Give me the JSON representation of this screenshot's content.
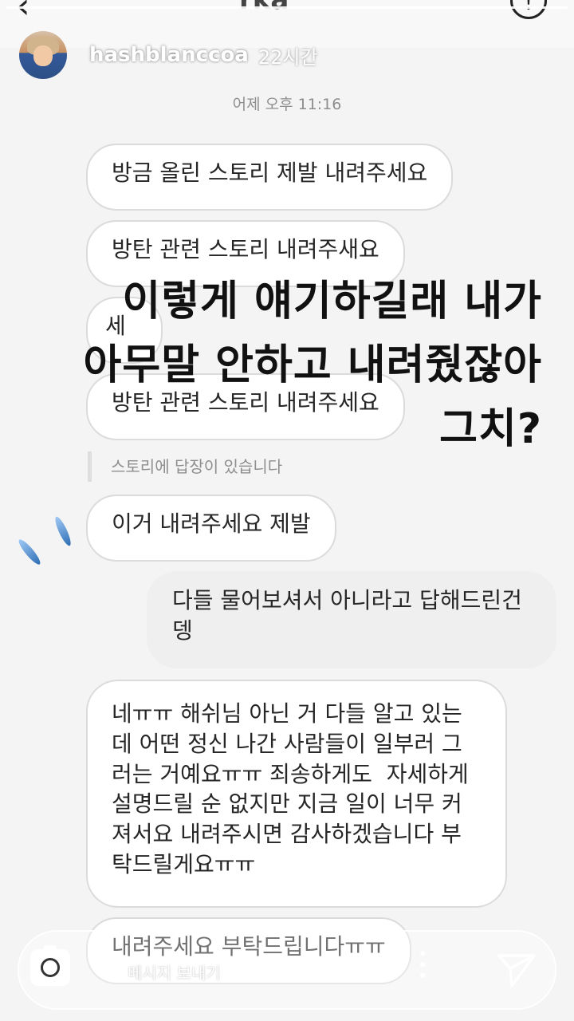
{
  "top_bar": {
    "back_glyph": "‹",
    "title_partial": "rka",
    "info_glyph": "!"
  },
  "story": {
    "username": "hashblanccoa",
    "time": "22시간"
  },
  "chat": {
    "date": "어제 오후 11:16",
    "messages": [
      {
        "text": "방금 올린 스토리 제발 내려주세요",
        "from": "other"
      },
      {
        "text": "방탄 관련 스토리 내려주새요",
        "from": "other"
      },
      {
        "text": "세",
        "from": "other"
      },
      {
        "text": "방탄 관련 스토리 내려주세요",
        "from": "other"
      },
      {
        "text": "이거 내려주세요 제발",
        "from": "other"
      },
      {
        "text": "다들 물어보셔서 아니라고 답해드린건\n뎅",
        "from": "me"
      },
      {
        "text": "네ㅠㅠ 해쉬님 아닌 거 다들 알고 있는\n데 어떤 정신 나간 사람들이 일부러 그\n러는 거예요ㅠㅠ 죄송하게도  자세하게\n설명드릴 순 없지만 지금 일이 너무 커\n져서요 내려주시면 감사하겠습니다 부\n탁드릴게요ㅠㅠ",
        "from": "other"
      },
      {
        "text": "내려주세요 부탁드립니다ㅠㅠ",
        "from": "other"
      }
    ],
    "reply_note": "스토리에 답장이 있습니다"
  },
  "overlay": {
    "lines": [
      "이렇게 얘기하길래 내가",
      "아무말 안하고 내려줬잖아",
      "그치?"
    ]
  },
  "composer": {
    "placeholder": "메시지 보내기"
  },
  "icons": {
    "camera": "camera-icon",
    "send": "send-icon",
    "more": "more-icon",
    "info": "info-icon",
    "back": "back-icon"
  }
}
